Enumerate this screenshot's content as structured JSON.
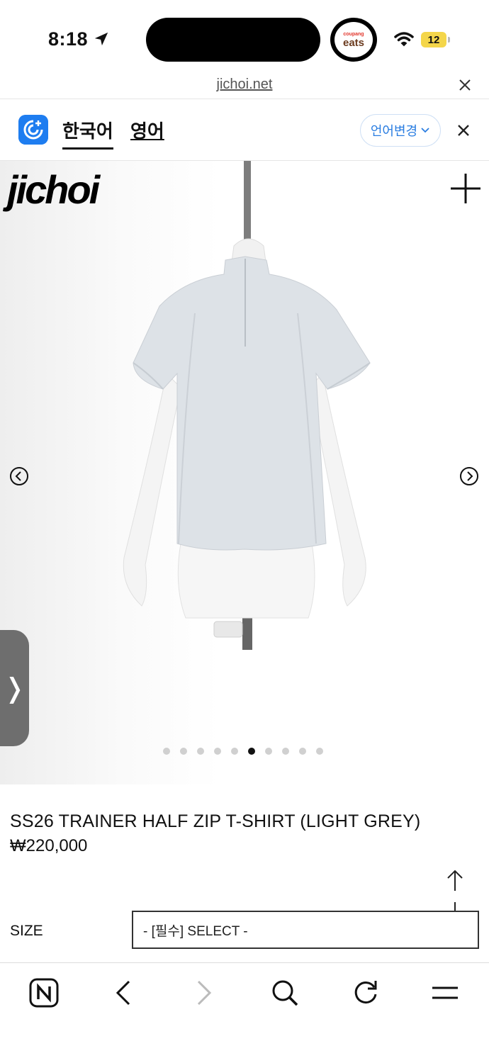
{
  "status": {
    "time": "8:18",
    "battery": "12",
    "eats_small": "coupang",
    "eats_big": "eats"
  },
  "browser": {
    "url": "jichoi.net"
  },
  "translate": {
    "lang_korean": "한국어",
    "lang_english": "영어",
    "change_language": "언어변경"
  },
  "brand": {
    "logo": "jichoi"
  },
  "carousel": {
    "total": 10,
    "active": 6
  },
  "product": {
    "name": "SS26 TRAINER HALF ZIP T-SHIRT (LIGHT GREY)",
    "price": "₩220,000",
    "size_label": "SIZE",
    "size_select_value": "- [필수] SELECT -"
  },
  "side_tab": {
    "glyph": "❭"
  },
  "icons": {
    "location": "location-arrow-icon",
    "wifi": "wifi-icon",
    "close": "close-icon",
    "plus": "plus-icon",
    "prev": "chevron-left-circle-icon",
    "next": "chevron-right-circle-icon",
    "naver": "naver-home-icon",
    "back": "back-icon",
    "forward": "forward-icon",
    "search": "search-icon",
    "reload": "reload-icon",
    "menu": "menu-icon"
  },
  "colors": {
    "accent": "#1e7df0",
    "link_blue": "#2a7de1",
    "battery": "#f4d64a",
    "shirt": "#dde2e7"
  }
}
